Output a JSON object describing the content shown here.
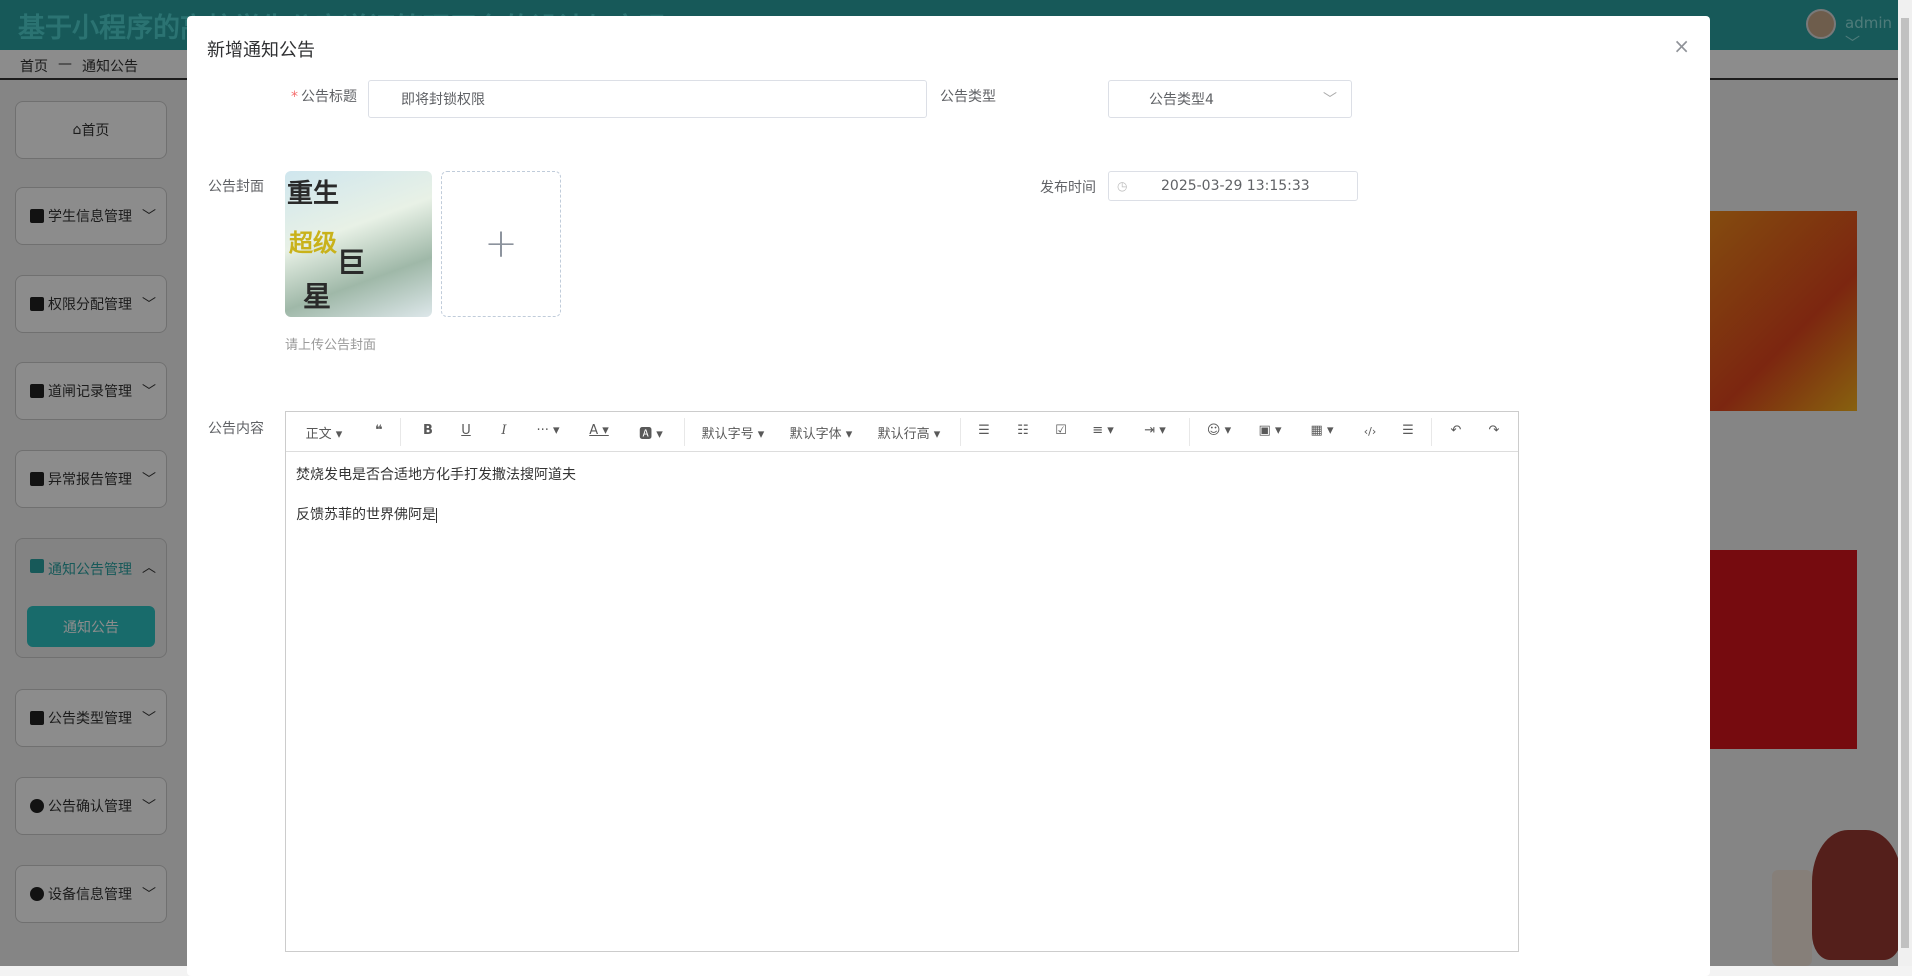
{
  "header": {
    "app_title": "基于小程序的高校学生公寓道闸管理平台的设计与实现",
    "user": "admin ﹀"
  },
  "breadcrumb": {
    "home": "首页",
    "sep": "—",
    "current": "通知公告"
  },
  "sidebar": {
    "items": [
      {
        "label": "首页"
      },
      {
        "label": "学生信息管理"
      },
      {
        "label": "权限分配管理"
      },
      {
        "label": "道闸记录管理"
      },
      {
        "label": "异常报告管理"
      },
      {
        "label": "通知公告管理"
      },
      {
        "label": "公告类型管理"
      },
      {
        "label": "公告确认管理"
      },
      {
        "label": "设备信息管理"
      }
    ],
    "active_sub": "通知公告"
  },
  "modal": {
    "title": "新增通知公告",
    "close": "×",
    "title_label": "公告标题",
    "title_value": "即将封锁权限",
    "type_label": "公告类型",
    "type_value": "公告类型4",
    "cover_label": "公告封面",
    "cover_lettering": [
      "重生",
      "超级",
      "巨",
      "星"
    ],
    "upload_plus": "+",
    "cover_hint": "请上传公告封面",
    "time_label": "发布时间",
    "time_value": "2025-03-29 13:15:33",
    "content_label": "公告内容",
    "toolbar": [
      "正文 ▾",
      "❝",
      "B",
      "U",
      "I",
      "··· ▾",
      "A ▾",
      "🅰 ▾",
      "默认字号 ▾",
      "默认字体 ▾",
      "默认行高 ▾",
      "☰",
      "☷",
      "☑",
      "≡ ▾",
      "⇥ ▾",
      "☺ ▾",
      "▣ ▾",
      "▦ ▾",
      "‹/›",
      "☰",
      "↶",
      "↷"
    ],
    "content": [
      "焚烧发电是否合适地方化手打发撒法搜阿道夫",
      "反馈苏菲的世界佛阿是"
    ]
  },
  "colors": {
    "accent": "#2ba3a3",
    "required": "#f56c6c"
  }
}
